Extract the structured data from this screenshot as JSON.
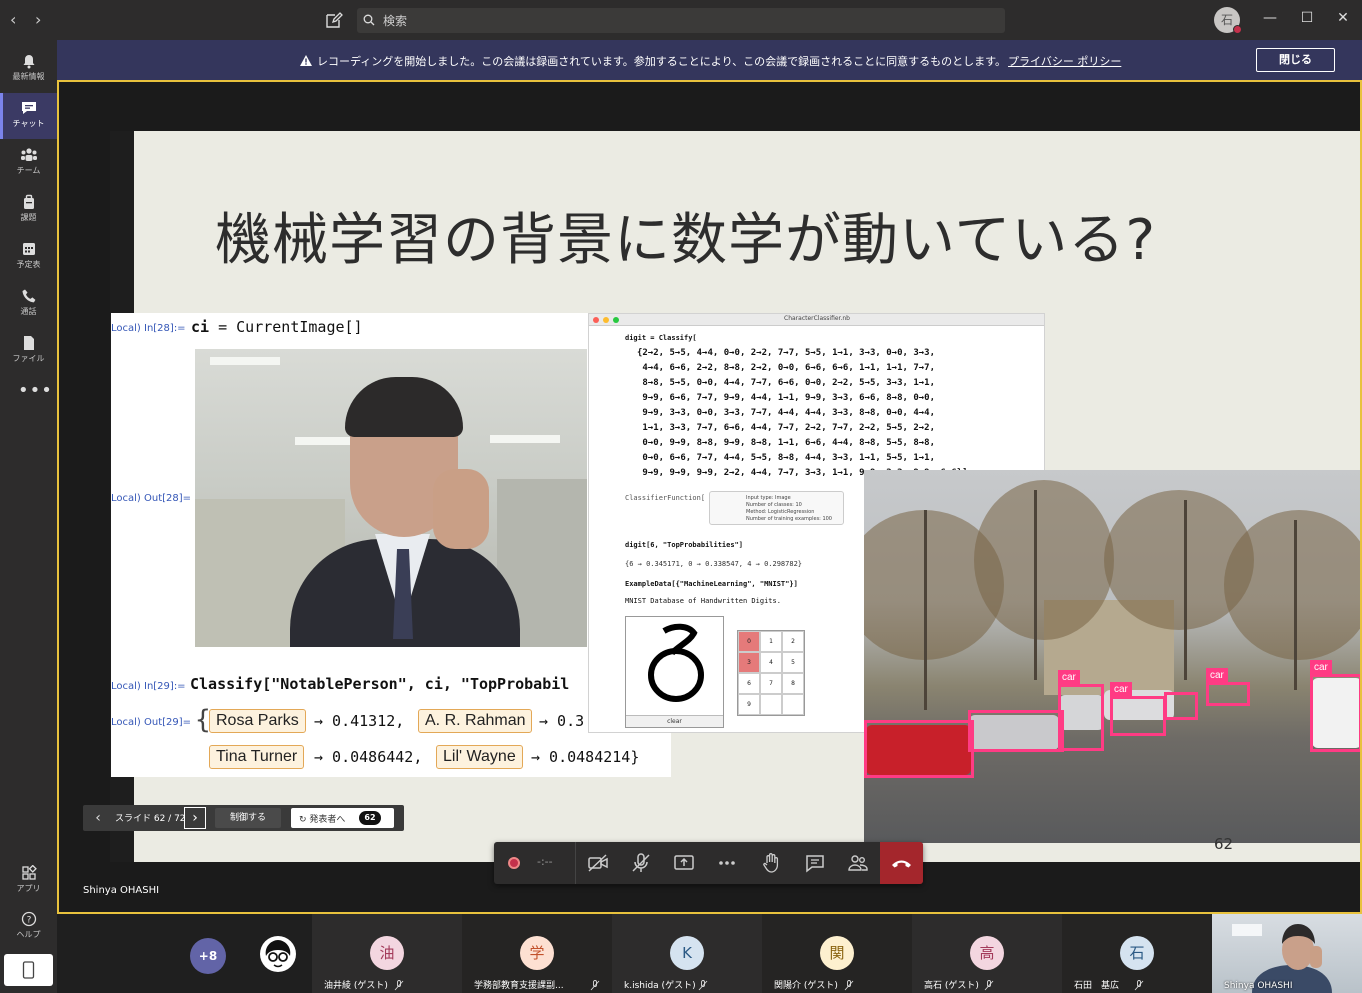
{
  "titlebar": {
    "back": "‹",
    "forward": "›",
    "search_placeholder": "検索",
    "user_initial": "石",
    "minimize": "—",
    "maximize": "☐",
    "close": "✕"
  },
  "rail": {
    "items": [
      {
        "label": "最新情報",
        "icon": "bell-icon"
      },
      {
        "label": "チャット",
        "icon": "chat-icon"
      },
      {
        "label": "チーム",
        "icon": "teams-icon"
      },
      {
        "label": "課題",
        "icon": "assignments-icon"
      },
      {
        "label": "予定表",
        "icon": "calendar-icon"
      },
      {
        "label": "通話",
        "icon": "phone-icon"
      },
      {
        "label": "ファイル",
        "icon": "file-icon"
      }
    ],
    "more": "•••",
    "apps_label": "アプリ",
    "help_label": "ヘルプ"
  },
  "banner": {
    "message": "レコーディングを開始しました。この会議は録画されています。参加することにより、この会議で録画されることに同意するものとします。",
    "link": "プライバシー ポリシー",
    "close_label": "閉じる"
  },
  "slide": {
    "title": "機械学習の背景に数学が動いている?",
    "number": "62",
    "mathematica": {
      "in28_label": "Local) In[28]:=",
      "in28_code_var": "ci",
      "in28_code_rest": " = CurrentImage[]",
      "out28_label": "Local) Out[28]=",
      "in29_label": "Local) In[29]:=",
      "in29_code": "Classify[\"NotablePerson\", ci, \"TopProbabil",
      "out29_label": "Local) Out[29]=",
      "results": [
        {
          "name": "Rosa Parks",
          "value": "→ 0.41312,"
        },
        {
          "name": "A. R. Rahman",
          "value": "→ 0.3"
        },
        {
          "name": "Tina Turner",
          "value": "→ 0.0486442,"
        },
        {
          "name": "Lil' Wayne",
          "value": "→ 0.0484214}"
        }
      ],
      "brace": "{"
    },
    "notebook": {
      "title": "CharacterClassifier.nb",
      "line1": "digit = Classify[",
      "digits": "{2→2, 5→5, 4→4, 0→0, 2→2, 7→7, 5→5, 1→1, 3→3, 0→0, 3→3,\n 4→4, 6→6, 2→2, 8→8, 2→2, 0→0, 6→6, 6→6, 1→1, 1→1, 7→7,\n 8→8, 5→5, 0→0, 4→4, 7→7, 6→6, 0→0, 2→2, 5→5, 3→3, 1→1,\n 9→9, 6→6, 7→7, 9→9, 4→4, 1→1, 9→9, 3→3, 6→6, 8→8, 0→0,\n 9→9, 3→3, 0→0, 3→3, 7→7, 4→4, 4→4, 3→3, 8→8, 0→0, 4→4,\n 1→1, 3→3, 7→7, 6→6, 4→4, 7→7, 2→2, 7→7, 2→2, 5→5, 2→2,\n 0→0, 9→9, 8→8, 9→9, 8→8, 1→1, 6→6, 4→4, 8→8, 5→5, 8→8,\n 0→0, 6→6, 7→7, 4→4, 5→5, 8→8, 4→4, 3→3, 1→1, 5→5, 1→1,\n 9→9, 9→9, 9→9, 2→2, 4→4, 7→7, 3→3, 1→1, 9→9, 2→2, 9→9, 6→6}]",
      "cf_label": "ClassifierFunction[",
      "cf_info": [
        "Input type: Image",
        "Number of classes: 10",
        "Method: LogisticRegression",
        "Number of training examples: 100"
      ],
      "line2": "digit[6, \"TopProbabilities\"]",
      "line3": "{6 → 0.345171, 0 → 0.338547, 4 → 0.298782}",
      "line4": "ExampleData[{\"MachineLearning\", \"MNIST\"}]",
      "line5": "MNIST Database of Handwritten Digits.",
      "clear": "clear",
      "grid": [
        "0",
        "1",
        "2",
        "3",
        "4",
        "5",
        "6",
        "7",
        "8",
        "9",
        "",
        ""
      ]
    },
    "detections": [
      "car",
      "car",
      "car",
      "car"
    ]
  },
  "slide_control": {
    "prev": "‹",
    "count": "スライド 62 / 72",
    "next": "›",
    "control_label": "制御する",
    "to_presenter": "発表者へ",
    "badge": "62"
  },
  "callbar": {
    "timer": "-:--"
  },
  "presenter_name": "Shinya OHASHI",
  "participants": {
    "overflow": "+8",
    "people": [
      {
        "initial": "油",
        "name": "油井綾 (ゲスト)",
        "bg": "#f3d6e0",
        "fg": "#a33a5a"
      },
      {
        "initial": "学",
        "name": "学務部教育支援課副...",
        "bg": "#fde0d2",
        "fg": "#c2512b"
      },
      {
        "initial": "K",
        "name": "k.ishida (ゲスト)",
        "bg": "#d5e3f0",
        "fg": "#2b5a85"
      },
      {
        "initial": "関",
        "name": "関陽介 (ゲスト)",
        "bg": "#fdf0cf",
        "fg": "#8a6410"
      },
      {
        "initial": "高",
        "name": "高石 (ゲスト)",
        "bg": "#f3d6e0",
        "fg": "#a33a5a"
      },
      {
        "initial": "石",
        "name": "石田　基広",
        "bg": "#d5e3f0",
        "fg": "#2b5a85"
      }
    ],
    "self_name": "Shinya OHASHI"
  },
  "colors": {
    "accent": "#6264a7",
    "stage_border": "#e8c23d",
    "hangup": "#a4262c",
    "detection": "#ff3b84"
  }
}
